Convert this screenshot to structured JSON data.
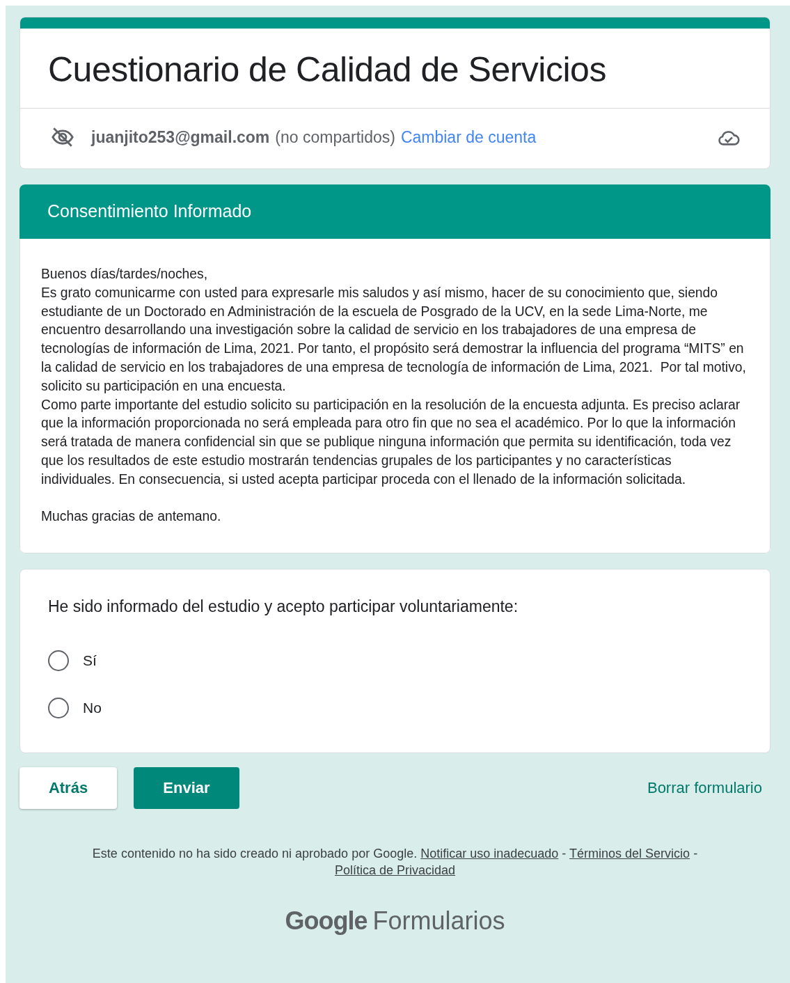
{
  "form": {
    "title": "Cuestionario de Calidad de Servicios"
  },
  "account": {
    "email": "juanjito253@gmail.com",
    "note": "(no compartidos)",
    "switch_link": "Cambiar de cuenta"
  },
  "section": {
    "title": "Consentimiento Informado",
    "paragraphs": [
      "Buenos días/tardes/noches,\nEs grato comunicarme con usted para expresarle mis saludos y así mismo, hacer de su conocimiento que, siendo estudiante de un Doctorado en Administración de la escuela de Posgrado de la UCV, en la sede Lima-Norte, me encuentro desarrollando una investigación sobre la calidad de servicio en los trabajadores de una empresa de tecnologías de información de Lima, 2021. Por tanto, el propósito será demostrar la influencia del programa “MITS” en la calidad de servicio en los trabajadores de una empresa de tecnología de información de Lima, 2021.  Por tal motivo, solicito su participación en una encuesta.\nComo parte importante del estudio solicito su participación en la resolución de la encuesta adjunta. Es preciso aclarar que la información proporcionada no será empleada para otro fin que no sea el académico. Por lo que la información será tratada de manera confidencial sin que se publique ninguna información que permita su identificación, toda vez que los resultados de este estudio mostrarán tendencias grupales de los participantes y no características individuales. En consecuencia, si usted acepta participar proceda con el llenado de la información solicitada.",
      "Muchas gracias de antemano."
    ]
  },
  "question": {
    "text": "He sido informado del estudio y acepto participar voluntariamente:",
    "options": [
      {
        "label": "Sí",
        "selected": false
      },
      {
        "label": "No",
        "selected": false
      }
    ]
  },
  "buttons": {
    "back": "Atrás",
    "submit": "Enviar",
    "clear": "Borrar formulario"
  },
  "footer": {
    "parts": [
      {
        "kind": "text",
        "text": "Este contenido no ha sido creado ni aprobado por Google."
      },
      {
        "kind": "link",
        "text": "Notificar uso inadecuado"
      },
      {
        "kind": "text",
        "text": "-"
      },
      {
        "kind": "link",
        "text": "Términos del Servicio"
      },
      {
        "kind": "text",
        "text": "-"
      },
      {
        "kind": "link",
        "text": "Política de Privacidad"
      }
    ],
    "brand": "Google",
    "product": "Formularios"
  }
}
